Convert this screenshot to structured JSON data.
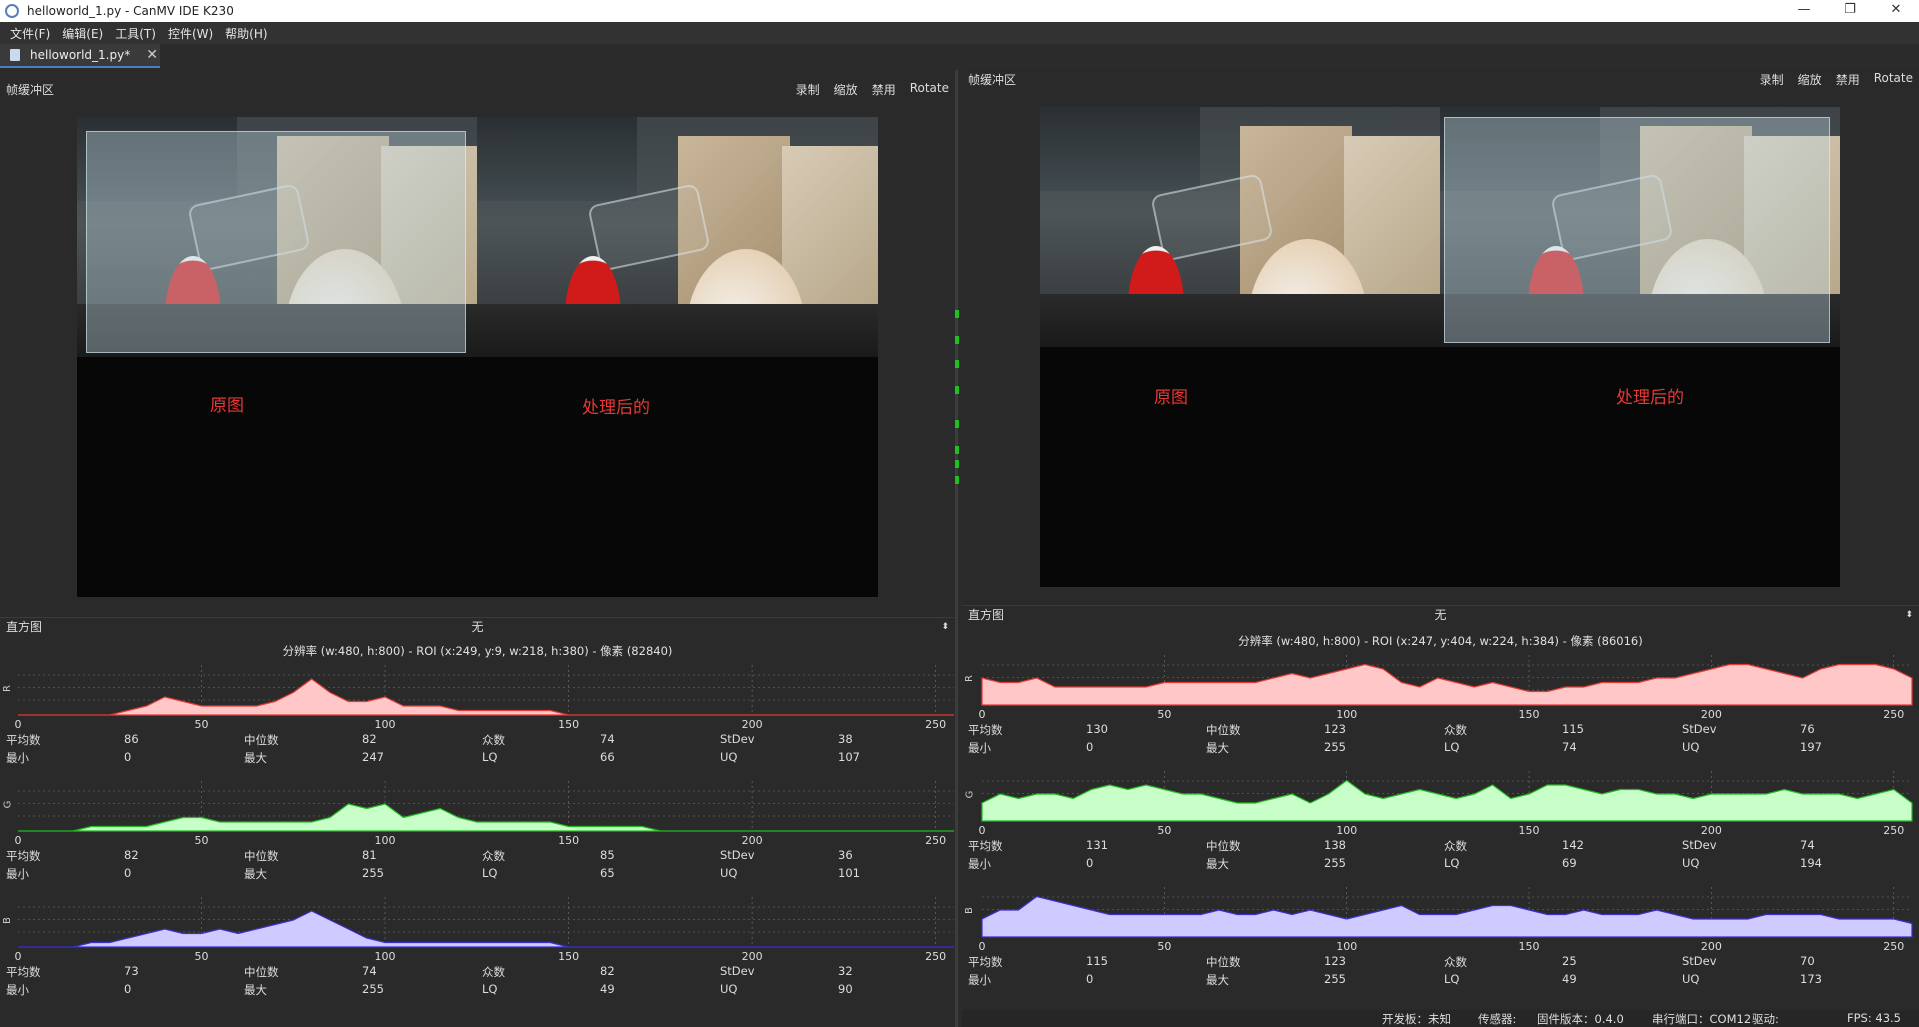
{
  "window": {
    "title": "helloworld_1.py - CanMV IDE K230",
    "minimize": "—",
    "maximize": "❐",
    "close": "✕"
  },
  "menu": [
    "文件(F)",
    "编辑(E)",
    "工具(T)",
    "控件(W)",
    "帮助(H)"
  ],
  "tab": {
    "label": "helloworld_1.py*",
    "close": "✕"
  },
  "framebuffer": {
    "name": "帧缓冲区",
    "actions": [
      "录制",
      "缩放",
      "禁用",
      "Rotate"
    ],
    "captions": [
      "原图",
      "处理后的"
    ]
  },
  "histogram_label": "直方图",
  "histogram_mode": "无",
  "histogram_arrow": "⬍",
  "axis_ticks": [
    "0",
    "50",
    "100",
    "150",
    "200",
    "250"
  ],
  "stat_labels": {
    "mean": "平均数",
    "median": "中位数",
    "mode": "众数",
    "stdev": "StDev",
    "min": "最小",
    "max": "最大",
    "lq": "LQ",
    "uq": "UQ"
  },
  "channel_labels": [
    "R",
    "G",
    "B"
  ],
  "left": {
    "info": "分辨率 (w:480, h:800) - ROI (x:249, y:9, w:218, h:380) - 像素 (82840)",
    "channels": [
      {
        "mean": "86",
        "median": "82",
        "mode": "74",
        "stdev": "38",
        "min": "0",
        "max": "247",
        "lq": "66",
        "uq": "107",
        "curve": [
          0,
          0,
          0,
          0,
          0,
          0,
          1,
          2,
          4,
          3,
          2,
          2,
          2,
          2,
          3,
          5,
          8,
          5,
          3,
          3,
          4,
          2,
          2,
          2,
          1,
          1,
          1,
          1,
          1,
          1,
          0,
          0,
          0,
          0,
          0,
          0,
          0,
          0,
          0,
          0,
          0,
          0,
          0,
          0,
          0,
          0,
          0,
          0,
          0,
          0,
          0,
          0
        ]
      },
      {
        "mean": "82",
        "median": "81",
        "mode": "85",
        "stdev": "36",
        "min": "0",
        "max": "255",
        "lq": "65",
        "uq": "101",
        "curve": [
          0,
          0,
          0,
          0,
          1,
          1,
          1,
          1,
          2,
          3,
          3,
          2,
          2,
          2,
          2,
          2,
          2,
          3,
          6,
          5,
          6,
          3,
          4,
          5,
          3,
          2,
          2,
          2,
          2,
          2,
          1,
          1,
          1,
          1,
          1,
          0,
          0,
          0,
          0,
          0,
          0,
          0,
          0,
          0,
          0,
          0,
          0,
          0,
          0,
          0,
          0,
          0
        ]
      },
      {
        "mean": "73",
        "median": "74",
        "mode": "82",
        "stdev": "32",
        "min": "0",
        "max": "255",
        "lq": "49",
        "uq": "90",
        "curve": [
          0,
          0,
          0,
          0,
          1,
          1,
          2,
          3,
          4,
          3,
          3,
          4,
          3,
          4,
          5,
          6,
          8,
          6,
          4,
          2,
          1,
          1,
          1,
          1,
          1,
          1,
          1,
          1,
          1,
          1,
          0,
          0,
          0,
          0,
          0,
          0,
          0,
          0,
          0,
          0,
          0,
          0,
          0,
          0,
          0,
          0,
          0,
          0,
          0,
          0,
          0,
          0
        ]
      }
    ]
  },
  "right": {
    "info": "分辨率 (w:480, h:800) - ROI (x:247, y:404, w:224, h:384) - 像素 (86016)",
    "channels": [
      {
        "mean": "130",
        "median": "123",
        "mode": "115",
        "stdev": "76",
        "min": "0",
        "max": "255",
        "lq": "74",
        "uq": "197",
        "curve": [
          6,
          5,
          5,
          6,
          4,
          4,
          4,
          4,
          4,
          4,
          5,
          5,
          5,
          5,
          5,
          5,
          6,
          7,
          6,
          7,
          8,
          9,
          8,
          5,
          4,
          6,
          5,
          4,
          5,
          4,
          3,
          3,
          4,
          4,
          5,
          5,
          5,
          6,
          6,
          7,
          8,
          9,
          9,
          8,
          7,
          6,
          8,
          9,
          9,
          9,
          8,
          6
        ]
      },
      {
        "mean": "131",
        "median": "138",
        "mode": "142",
        "stdev": "74",
        "min": "0",
        "max": "255",
        "lq": "69",
        "uq": "194",
        "curve": [
          4,
          6,
          5,
          6,
          6,
          5,
          7,
          8,
          7,
          8,
          7,
          6,
          6,
          5,
          4,
          4,
          5,
          6,
          4,
          6,
          9,
          6,
          5,
          6,
          7,
          6,
          5,
          6,
          8,
          5,
          6,
          8,
          8,
          7,
          6,
          7,
          7,
          6,
          6,
          5,
          6,
          6,
          6,
          6,
          7,
          6,
          6,
          6,
          5,
          6,
          7,
          4
        ]
      },
      {
        "mean": "115",
        "median": "123",
        "mode": "25",
        "stdev": "70",
        "min": "0",
        "max": "255",
        "lq": "49",
        "uq": "173",
        "curve": [
          4,
          6,
          6,
          9,
          8,
          7,
          6,
          5,
          5,
          5,
          5,
          5,
          5,
          6,
          5,
          5,
          6,
          5,
          6,
          5,
          4,
          5,
          6,
          7,
          5,
          5,
          5,
          6,
          7,
          7,
          6,
          5,
          5,
          6,
          5,
          5,
          5,
          6,
          5,
          4,
          4,
          4,
          4,
          5,
          5,
          5,
          5,
          4,
          4,
          4,
          4,
          3
        ]
      }
    ]
  },
  "status": {
    "board": "开发板：未知",
    "sensor": "传感器:",
    "firmware": "固件版本：0.4.0",
    "serial": "串行端口：COM12",
    "driver": "驱动:",
    "fps": "FPS:  43.5"
  },
  "colors": {
    "r_fill": "#ffc7c7",
    "r_line": "#e53935",
    "g_fill": "#c8ffc8",
    "g_line": "#22bb22",
    "b_fill": "#cfcaff",
    "b_line": "#3a2fd0"
  }
}
